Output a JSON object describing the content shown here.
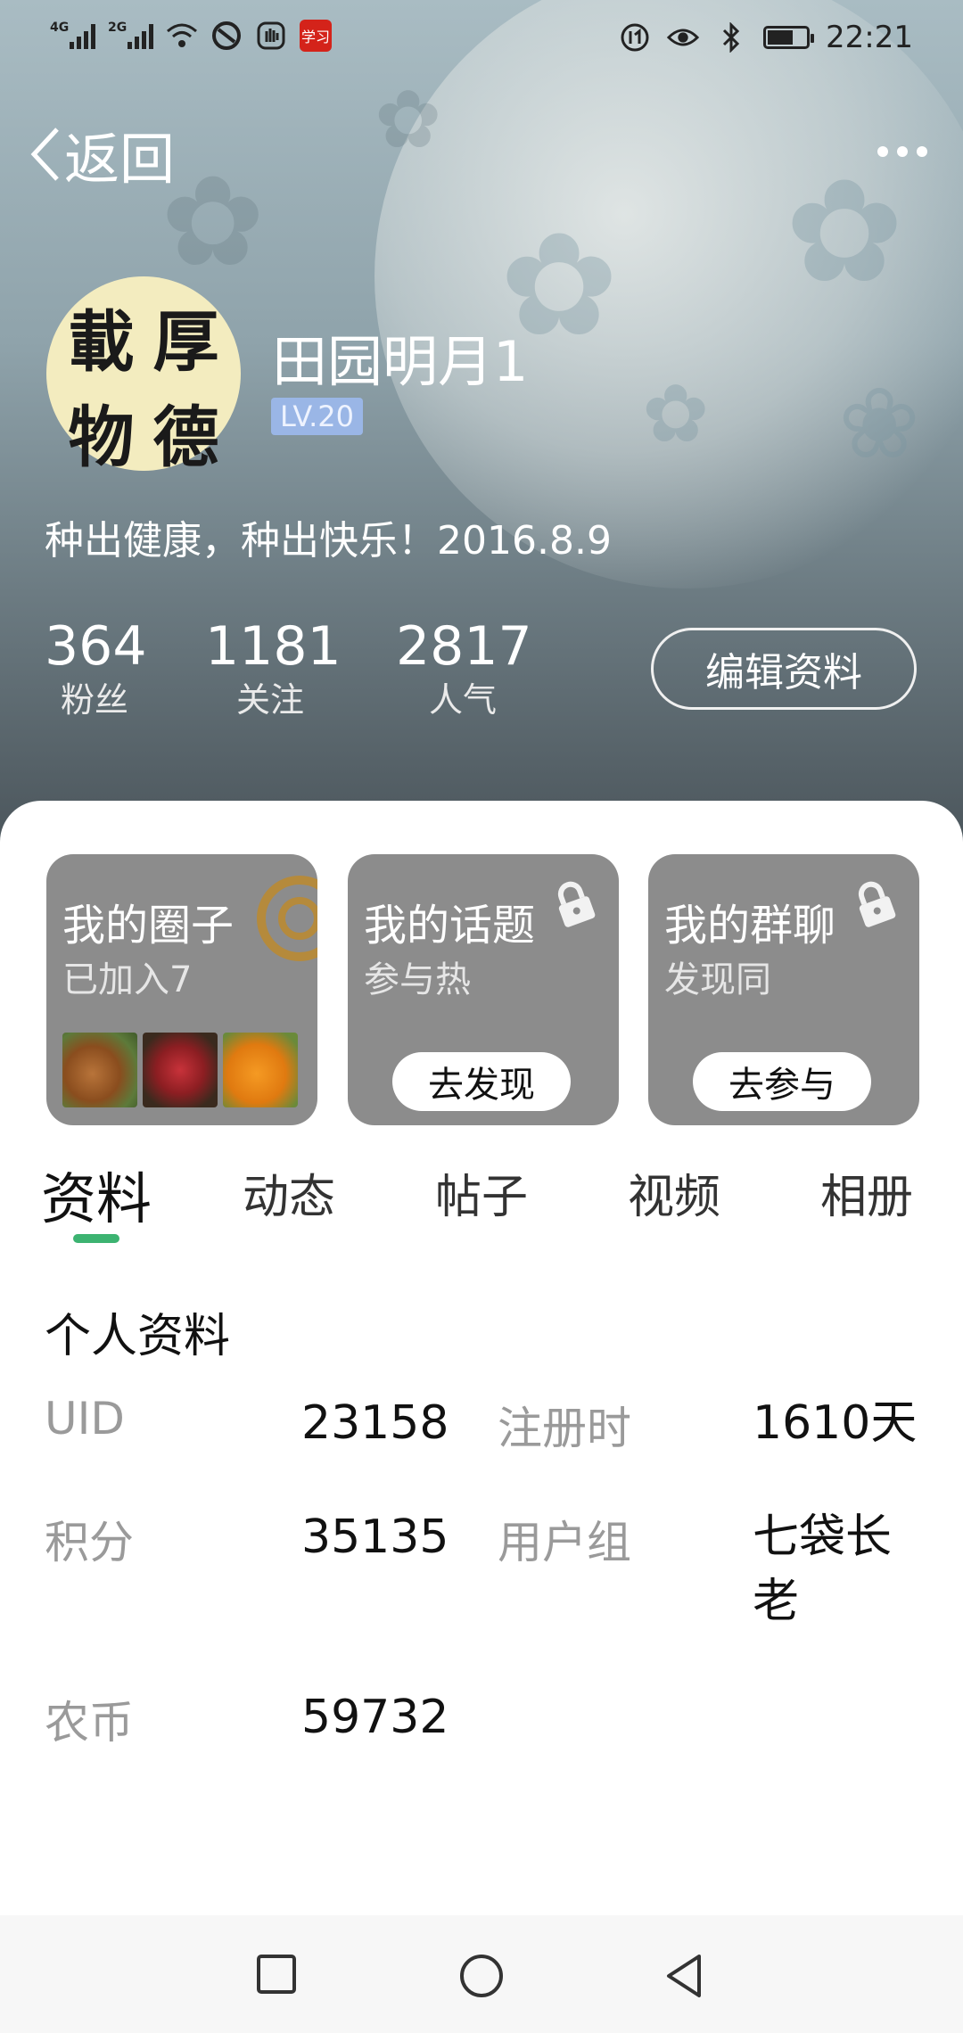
{
  "status_bar": {
    "net1": "4G",
    "net2": "2G",
    "badge_text": "学习",
    "time": "22:21"
  },
  "header": {
    "back_label": "返回",
    "more_icon": "more-dots-icon"
  },
  "profile": {
    "avatar_chars": [
      "載",
      "厚",
      "物",
      "德"
    ],
    "username": "田园明月1",
    "level": "LV.20",
    "signature": "种出健康，种出快乐！2016.8.9",
    "stats": [
      {
        "value": "364",
        "label": "粉丝"
      },
      {
        "value": "1181",
        "label": "关注"
      },
      {
        "value": "2817",
        "label": "人气"
      }
    ],
    "edit_button": "编辑资料"
  },
  "cards": [
    {
      "title": "我的圈子",
      "subtitle": "已加入7"
    },
    {
      "title": "我的话题",
      "subtitle": "参与热",
      "button": "去发现"
    },
    {
      "title": "我的群聊",
      "subtitle": "发现同",
      "button": "去参与"
    }
  ],
  "tabs": [
    "资料",
    "动态",
    "帖子",
    "视频",
    "相册"
  ],
  "active_tab": "资料",
  "info": {
    "section_title": "个人资料",
    "fields": {
      "uid_label": "UID",
      "uid_value": "23158",
      "reg_label": "注册时",
      "reg_value": "1610天",
      "points_label": "积分",
      "points_value": "35135",
      "group_label": "用户组",
      "group_value": "七袋长老",
      "coin_label": "农币",
      "coin_value": "59732"
    }
  },
  "colors": {
    "accent": "#3cb371",
    "level_badge": "#9ab6e6",
    "card_bg": "#8c8c8c"
  }
}
